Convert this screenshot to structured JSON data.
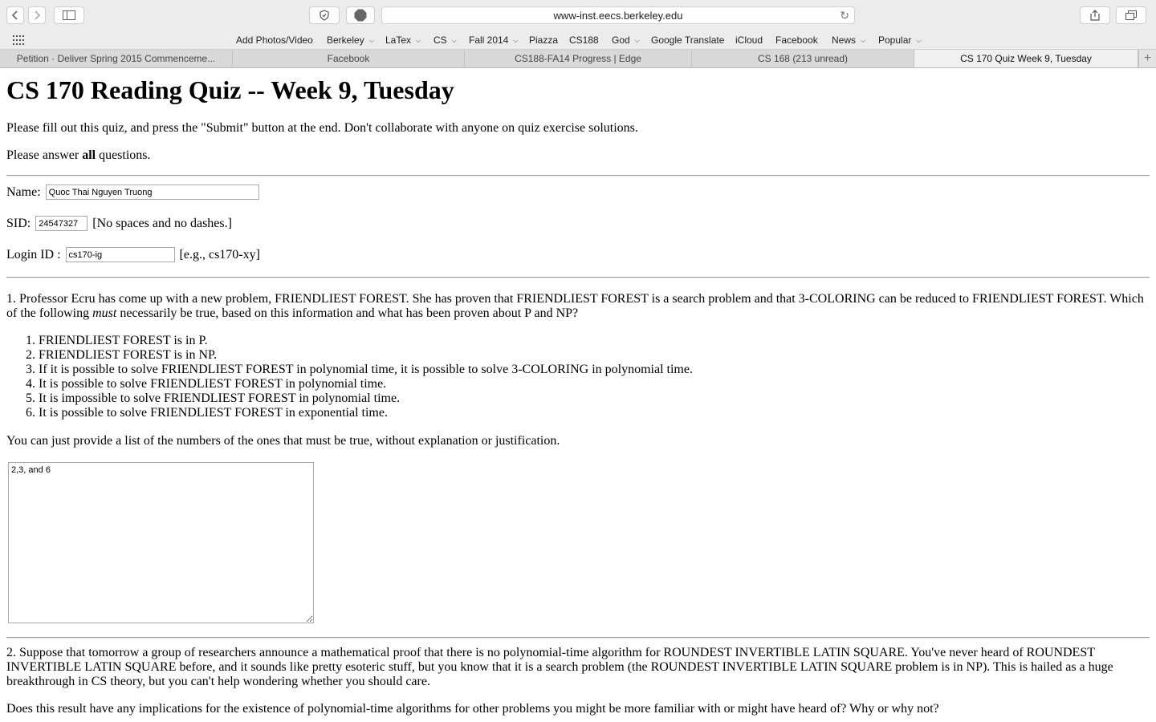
{
  "browser": {
    "url": "www-inst.eecs.berkeley.edu",
    "bookmarks": [
      {
        "label": "Add Photos/Video",
        "menu": false
      },
      {
        "label": "Berkeley",
        "menu": true
      },
      {
        "label": "LaTex",
        "menu": true
      },
      {
        "label": "CS",
        "menu": true
      },
      {
        "label": "Fall 2014",
        "menu": true
      },
      {
        "label": "Piazza",
        "menu": false
      },
      {
        "label": "CS188",
        "menu": false
      },
      {
        "label": "God",
        "menu": true
      },
      {
        "label": "Google Translate",
        "menu": false
      },
      {
        "label": "iCloud",
        "menu": false
      },
      {
        "label": "Facebook",
        "menu": false
      },
      {
        "label": "News",
        "menu": true
      },
      {
        "label": "Popular",
        "menu": true
      }
    ],
    "tabs": [
      {
        "label": "Petition · Deliver Spring 2015 Commenceme...",
        "active": false
      },
      {
        "label": "Facebook",
        "active": false
      },
      {
        "label": "CS188-FA14 Progress | Edge",
        "active": false
      },
      {
        "label": "CS 168 (213 unread)",
        "active": false
      },
      {
        "label": "CS 170 Quiz Week 9, Tuesday",
        "active": true
      }
    ],
    "adblock_label": "ABP"
  },
  "page": {
    "title": "CS 170 Reading Quiz -- Week 9, Tuesday",
    "intro": "Please fill out this quiz, and press the \"Submit\" button at the end. Don't collaborate with anyone on quiz exercise solutions.",
    "answer_all_pre": "Please answer ",
    "answer_all_bold": "all",
    "answer_all_post": " questions.",
    "name_label": "Name:",
    "name_value": "Quoc Thai Nguyen Truong",
    "sid_label": "SID:",
    "sid_value": "24547327",
    "sid_hint": "[No spaces and no dashes.]",
    "login_label": "Login ID :",
    "login_value": "cs170-ig",
    "login_hint": "[e.g., cs170-xy]",
    "q1_pre": "1. Professor Ecru has come up with a new problem, FRIENDLIEST FOREST. She has proven that FRIENDLIEST FOREST is a search problem and that 3-COLORING can be reduced to FRIENDLIEST FOREST. Which of the following ",
    "q1_em": "must",
    "q1_post": " necessarily be true, based on this information and what has been proven about P and NP?",
    "q1_options": [
      "FRIENDLIEST FOREST is in P.",
      "FRIENDLIEST FOREST is in NP.",
      "If it is possible to solve FRIENDLIEST FOREST in polynomial time, it is possible to solve 3-COLORING in polynomial time.",
      "It is possible to solve FRIENDLIEST FOREST in polynomial time.",
      "It is impossible to solve FRIENDLIEST FOREST in polynomial time.",
      "It is possible to solve FRIENDLIEST FOREST in exponential time."
    ],
    "q1_note": "You can just provide a list of the numbers of the ones that must be true, without explanation or justification.",
    "q1_answer": "2,3, and 6",
    "q2": "2. Suppose that tomorrow a group of researchers announce a mathematical proof that there is no polynomial-time algorithm for ROUNDEST INVERTIBLE LATIN SQUARE. You've never heard of ROUNDEST INVERTIBLE LATIN SQUARE before, and it sounds like pretty esoteric stuff, but you know that it is a search problem (the ROUNDEST INVERTIBLE LATIN SQUARE problem is in NP). This is hailed as a huge breakthrough in CS theory, but you can't help wondering whether you should care.",
    "q2b": "Does this result have any implications for the existence of polynomial-time algorithms for other problems you might be more familiar with or might have heard of? Why or why not?"
  }
}
